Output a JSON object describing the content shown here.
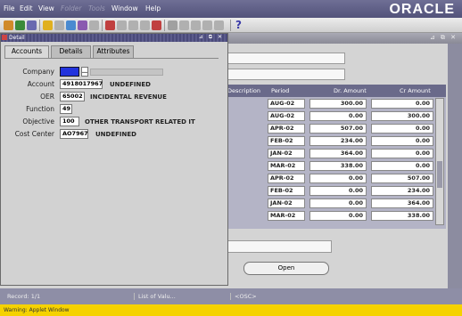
{
  "menu": {
    "items": [
      "File",
      "Edit",
      "View",
      "Folder",
      "Tools",
      "Window",
      "Help"
    ],
    "disabled": [
      "Folder",
      "Tools"
    ]
  },
  "branding": {
    "logo": "ORACLE"
  },
  "toolbar": {
    "help_icon": "?"
  },
  "detail": {
    "title": "Detail",
    "window_controls": "⊿ ⧉ ✕",
    "tabs": [
      {
        "label": "Accounts",
        "active": true
      },
      {
        "label": "Details",
        "active": false
      },
      {
        "label": "Attributes",
        "active": false
      }
    ],
    "fields": {
      "company": {
        "label": "Company",
        "value": "",
        "selected_color": "#2233dd"
      },
      "account": {
        "label": "Account",
        "value": "4918017967",
        "description": "UNDEFINED"
      },
      "oer": {
        "label": "OER",
        "value": "65002",
        "description": "INCIDENTAL REVENUE"
      },
      "function": {
        "label": "Function",
        "value": "49"
      },
      "objective": {
        "label": "Objective",
        "value": "100",
        "description": "OTHER TRANSPORT RELATED IT"
      },
      "cost_center": {
        "label": "Cost Center",
        "value": "AO7967",
        "description": "UNDEFINED"
      }
    }
  },
  "grid": {
    "columns": [
      "Description",
      "Period",
      "Dr. Amount",
      "Cr Amount"
    ],
    "rows": [
      {
        "period": "AUG-02",
        "dr": "300.00",
        "cr": "0.00"
      },
      {
        "period": "AUG-02",
        "dr": "0.00",
        "cr": "300.00"
      },
      {
        "period": "APR-02",
        "dr": "507.00",
        "cr": "0.00"
      },
      {
        "period": "FEB-02",
        "dr": "234.00",
        "cr": "0.00"
      },
      {
        "period": "JAN-02",
        "dr": "364.00",
        "cr": "0.00"
      },
      {
        "period": "MAR-02",
        "dr": "338.00",
        "cr": "0.00"
      },
      {
        "period": "APR-02",
        "dr": "0.00",
        "cr": "507.00"
      },
      {
        "period": "FEB-02",
        "dr": "0.00",
        "cr": "234.00"
      },
      {
        "period": "JAN-02",
        "dr": "0.00",
        "cr": "364.00"
      },
      {
        "period": "MAR-02",
        "dr": "0.00",
        "cr": "338.00"
      }
    ]
  },
  "actions": {
    "open_label": "Open"
  },
  "status": {
    "record": "Record: 1/1",
    "list_of_values": "List of Valu...",
    "osc": "<OSC>",
    "warning": "Warning: Applet Window"
  },
  "colors": {
    "menubar": "#5e5e86",
    "statusbar": "#8e8ea6",
    "warning": "#f5d200"
  }
}
